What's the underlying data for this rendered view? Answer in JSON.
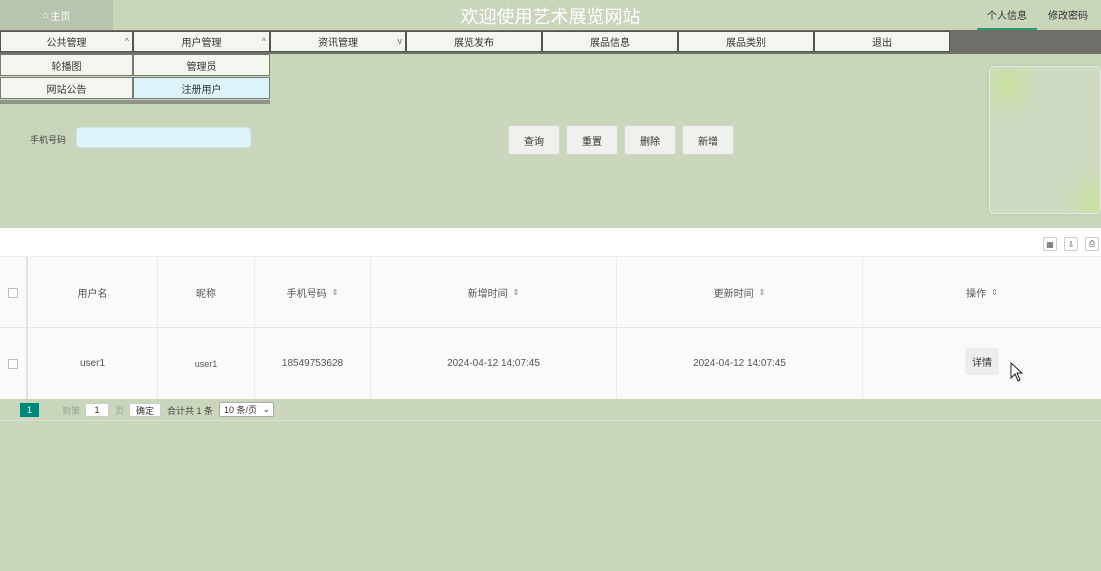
{
  "header": {
    "home_label": "主页",
    "site_title": "欢迎使用艺术展览网站",
    "user_info": "个人信息",
    "change_password": "修改密码"
  },
  "nav": {
    "items": [
      {
        "label": "公共管理",
        "chevron": "^"
      },
      {
        "label": "用户管理",
        "chevron": "^"
      },
      {
        "label": "资讯管理",
        "chevron": "v"
      },
      {
        "label": "展览发布"
      },
      {
        "label": "展品信息"
      },
      {
        "label": "展品类别"
      },
      {
        "label": "退出"
      }
    ],
    "public_sub": [
      "轮播图",
      "网站公告"
    ],
    "user_sub": [
      "管理员",
      "注册用户"
    ]
  },
  "search": {
    "phone_label": "手机号码",
    "phone_value": "",
    "buttons": {
      "query": "查询",
      "reset": "重置",
      "delete": "删除",
      "add": "新增"
    }
  },
  "table": {
    "columns": [
      "用户名",
      "昵称",
      "手机号码",
      "新增时间",
      "更新时间",
      "操作"
    ],
    "rows": [
      {
        "username": "user1",
        "nickname": "user1",
        "phone": "18549753628",
        "created": "2024-04-12 14:07:45",
        "updated": "2024-04-12 14:07:45",
        "action": "详情"
      }
    ]
  },
  "pagination": {
    "current": "1",
    "goto_prefix": "到第",
    "goto_value": "1",
    "goto_suffix": "页",
    "confirm": "确定",
    "total": "合计共 1 条",
    "page_size": "10 条/页"
  },
  "colors": {
    "background": "#cad6bc",
    "accent": "#00877a",
    "user_info_underline": "#2a9d6a"
  }
}
